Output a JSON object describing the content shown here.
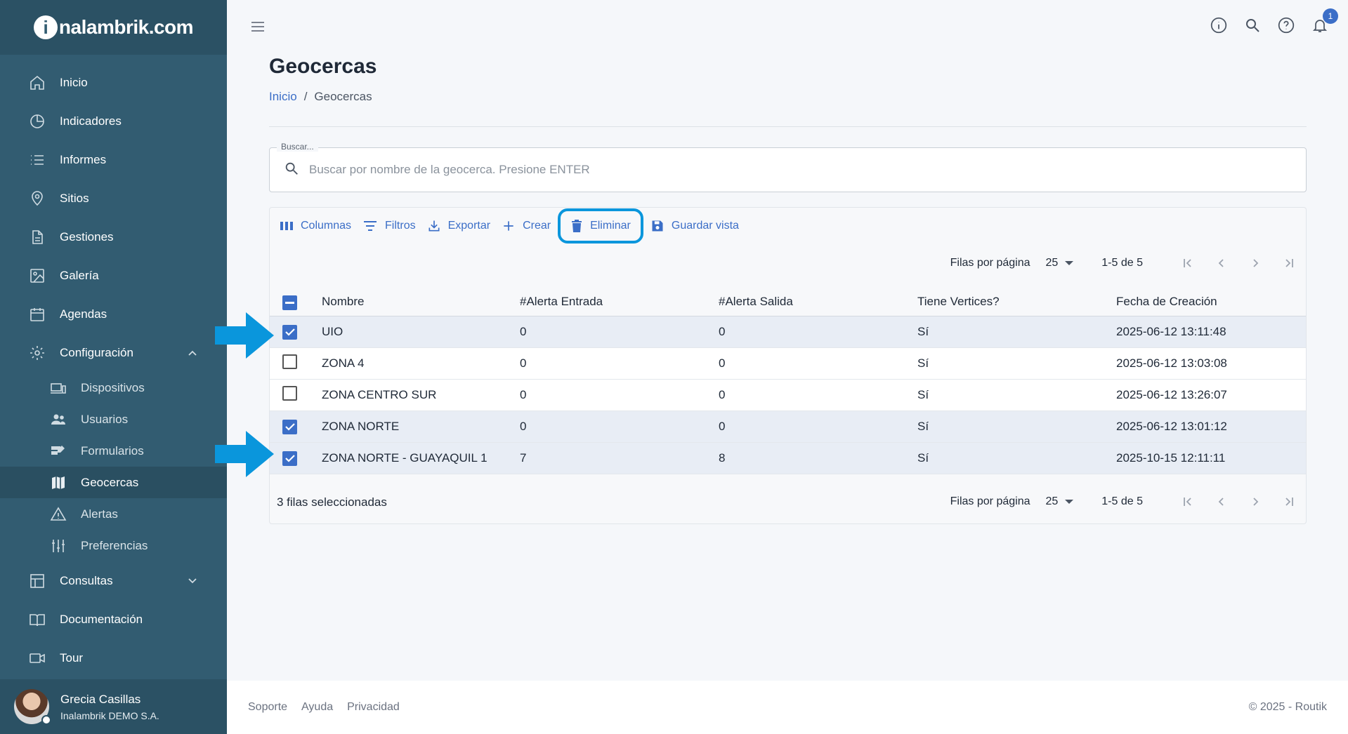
{
  "brand": {
    "logo_i": "i",
    "logo_rest": "nalambrik.com"
  },
  "sidebar": {
    "items": [
      {
        "label": "Inicio",
        "icon": "home-icon"
      },
      {
        "label": "Indicadores",
        "icon": "pie-chart-icon"
      },
      {
        "label": "Informes",
        "icon": "list-icon"
      },
      {
        "label": "Sitios",
        "icon": "location-pin-icon"
      },
      {
        "label": "Gestiones",
        "icon": "document-icon"
      },
      {
        "label": "Galería",
        "icon": "image-icon"
      },
      {
        "label": "Agendas",
        "icon": "calendar-icon"
      },
      {
        "label": "Configuración",
        "icon": "gear-icon"
      }
    ],
    "sub_items": [
      {
        "label": "Dispositivos",
        "icon": "devices-icon"
      },
      {
        "label": "Usuarios",
        "icon": "users-icon"
      },
      {
        "label": "Formularios",
        "icon": "forms-icon"
      },
      {
        "label": "Geocercas",
        "icon": "map-icon"
      },
      {
        "label": "Alertas",
        "icon": "warning-icon"
      },
      {
        "label": "Preferencias",
        "icon": "sliders-icon"
      }
    ],
    "bottom_items": [
      {
        "label": "Consultas",
        "icon": "table-icon"
      },
      {
        "label": "Documentación",
        "icon": "book-icon"
      },
      {
        "label": "Tour",
        "icon": "video-icon"
      }
    ],
    "user": {
      "name": "Grecia Casillas",
      "org": "Inalambrik DEMO S.A."
    }
  },
  "header": {
    "notifications_count": "1"
  },
  "page": {
    "title": "Geocercas",
    "breadcrumb": {
      "home": "Inicio",
      "sep": "/",
      "current": "Geocercas"
    }
  },
  "search": {
    "legend": "Buscar...",
    "placeholder": "Buscar por nombre de la geocerca. Presione ENTER"
  },
  "toolbar": {
    "columns": "Columnas",
    "filters": "Filtros",
    "export": "Exportar",
    "create": "Crear",
    "delete": "Eliminar",
    "save_view": "Guardar vista"
  },
  "pagination": {
    "rows_per_page_label": "Filas por página",
    "rows_per_page": "25",
    "range": "1-5 de 5"
  },
  "table": {
    "columns": [
      "Nombre",
      "#Alerta Entrada",
      "#Alerta Salida",
      "Tiene Vertices?",
      "Fecha de Creación"
    ],
    "rows": [
      {
        "selected": true,
        "name": "UIO",
        "alerta_entrada": "0",
        "alerta_salida": "0",
        "vertices": "Sí",
        "fecha": "2025-06-12 13:11:48"
      },
      {
        "selected": false,
        "name": "ZONA 4",
        "alerta_entrada": "0",
        "alerta_salida": "0",
        "vertices": "Sí",
        "fecha": "2025-06-12 13:03:08"
      },
      {
        "selected": false,
        "name": "ZONA CENTRO SUR",
        "alerta_entrada": "0",
        "alerta_salida": "0",
        "vertices": "Sí",
        "fecha": "2025-06-12 13:26:07"
      },
      {
        "selected": true,
        "name": "ZONA NORTE",
        "alerta_entrada": "0",
        "alerta_salida": "0",
        "vertices": "Sí",
        "fecha": "2025-06-12 13:01:12"
      },
      {
        "selected": true,
        "name": "ZONA NORTE - GUAYAQUIL 1",
        "alerta_entrada": "7",
        "alerta_salida": "8",
        "vertices": "Sí",
        "fecha": "2025-10-15 12:11:11"
      }
    ],
    "selected_summary": "3 filas seleccionadas"
  },
  "footer": {
    "links": [
      "Soporte",
      "Ayuda",
      "Privacidad"
    ],
    "copyright": "© 2025 - Routik"
  },
  "colors": {
    "sidebar": "#325c71",
    "accent": "#3b6ec7",
    "highlight": "#0a96dc"
  }
}
